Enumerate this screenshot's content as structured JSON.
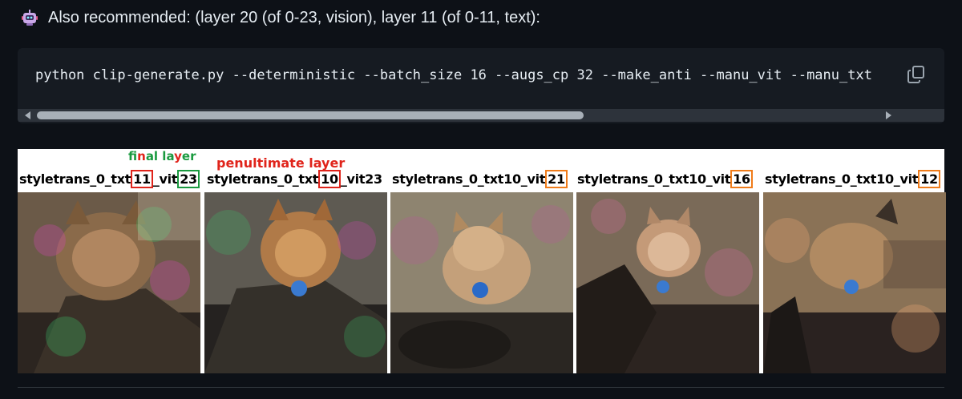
{
  "heading": {
    "text": "Also recommended: (layer 20 (of 0-23, vision), layer 11 (of 0-11, text):"
  },
  "code": {
    "command": "python clip-generate.py --deterministic --batch_size 16 --augs_cp 32 --make_anti --manu_vit --manu_txt"
  },
  "icons": {
    "robot": "robot-icon",
    "copy": "copy-icon"
  },
  "figure": {
    "annotation_final": {
      "part1": "fi",
      "part2": "n",
      "part3": "al la",
      "part4": "y",
      "part5": "er"
    },
    "annotation_penultimate": "penultimate layer",
    "captions": [
      {
        "prefix": "styletrans_0_txt",
        "txt": "11",
        "mid": "_vit",
        "vit": "23"
      },
      {
        "prefix": "styletrans_0_txt",
        "txt": "10",
        "mid": "_vit23",
        "vit": ""
      },
      {
        "prefix": "styletrans_0_txt10_vit",
        "txt": "",
        "mid": "",
        "vit": "21"
      },
      {
        "prefix": "styletrans_0_txt10_vit",
        "txt": "",
        "mid": "",
        "vit": "16"
      },
      {
        "prefix": "styletrans_0_txt10_vit",
        "txt": "",
        "mid": "",
        "vit": "12"
      }
    ]
  },
  "colors": {
    "background": "#0d1117",
    "code_bg": "#161b22",
    "red_box": "#e0241b",
    "green_box": "#1a9a3f",
    "orange_box": "#f07c1a"
  }
}
